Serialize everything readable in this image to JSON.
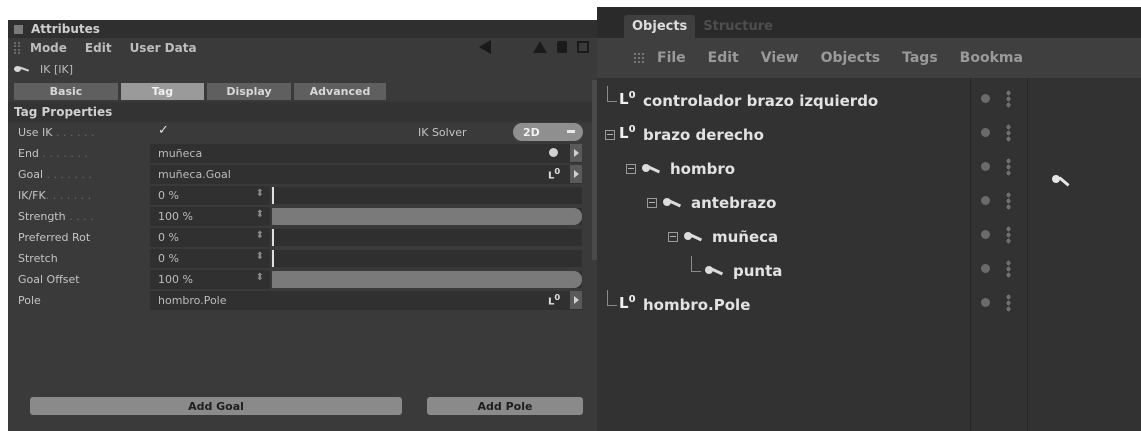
{
  "attributes": {
    "title": "Attributes",
    "menu": [
      "Mode",
      "Edit",
      "User Data"
    ],
    "object_label": "IK [IK]",
    "tabs": [
      {
        "label": "Basic",
        "active": false
      },
      {
        "label": "Tag",
        "active": true
      },
      {
        "label": "Display",
        "active": false
      },
      {
        "label": "Advanced",
        "active": false
      }
    ],
    "section_title": "Tag Properties",
    "use_ik": {
      "label": "Use IK",
      "dots": " . . . . . .",
      "checked": true,
      "check_glyph": "✓"
    },
    "ik_solver": {
      "label": "IK Solver",
      "value": "2D"
    },
    "end": {
      "label": "End",
      "dots": " . . . . . . .",
      "value": "muñeca"
    },
    "goal": {
      "label": "Goal",
      "dots": " . . . . . . .",
      "value": "muñeca.Goal"
    },
    "ik_fk": {
      "label": "IK/FK",
      "dots": ". . . . . . .",
      "value": "0 %",
      "level": 0
    },
    "strength": {
      "label": "Strength",
      "dots": " . . . .",
      "value": "100 %",
      "level": 100
    },
    "preferred_rot": {
      "label": "Preferred Rot",
      "value": "0 %",
      "level": 0
    },
    "stretch": {
      "label": "Stretch",
      "value": "0 %",
      "level": 0
    },
    "goal_offset": {
      "label": "Goal Offset",
      "value": "100 %",
      "level": 100
    },
    "pole": {
      "label": "Pole",
      "value": "hombro.Pole"
    },
    "add_goal": "Add Goal",
    "add_pole": "Add Pole"
  },
  "objects": {
    "tabs": [
      {
        "label": "Objects",
        "active": true
      },
      {
        "label": "Structure",
        "active": false
      }
    ],
    "menu": [
      "File",
      "Edit",
      "View",
      "Objects",
      "Tags",
      "Bookma"
    ],
    "tree": [
      {
        "name": "controlador brazo izquierdo",
        "icon": "null-object-icon",
        "depth": 0
      },
      {
        "name": "brazo derecho",
        "icon": "null-object-icon",
        "depth": 0,
        "expanded": true
      },
      {
        "name": "hombro",
        "icon": "joint-icon",
        "depth": 1,
        "expanded": true
      },
      {
        "name": "antebrazo",
        "icon": "joint-icon",
        "depth": 2,
        "expanded": true
      },
      {
        "name": "muñeca",
        "icon": "joint-icon",
        "depth": 3,
        "expanded": true
      },
      {
        "name": "punta",
        "icon": "joint-icon",
        "depth": 4
      },
      {
        "name": "hombro.Pole",
        "icon": "null-object-icon",
        "depth": 0
      }
    ],
    "null_glyph": "L",
    "null_sup": "0"
  },
  "colors": {
    "panel_bg": "#3a3a3a",
    "field_bg": "#303030",
    "tab_active": "#9a9a9a",
    "text": "#c9c9c9"
  }
}
